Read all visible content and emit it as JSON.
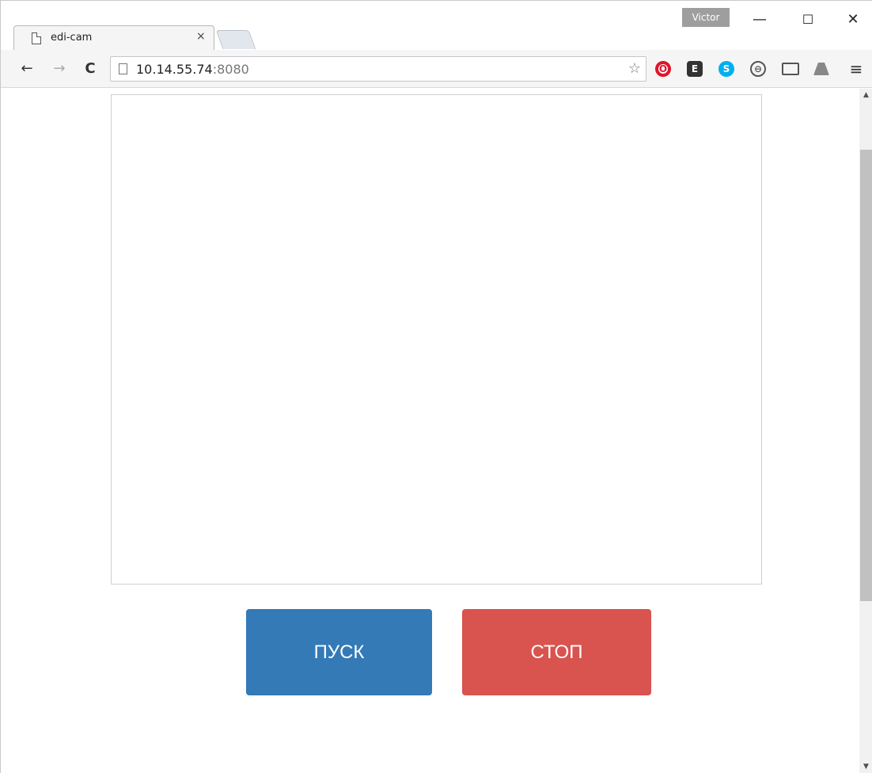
{
  "window": {
    "profile_name": "Victor",
    "minimize_glyph": "—",
    "maximize_glyph": "☐",
    "close_glyph": "✕"
  },
  "tab": {
    "title": "edi-cam",
    "close_glyph": "×"
  },
  "toolbar": {
    "back_glyph": "←",
    "forward_glyph": "→",
    "reload_glyph": "C",
    "url_host": "10.14.55.74",
    "url_port": ":8080",
    "bookmark_glyph": "☆",
    "menu_glyph": "≡"
  },
  "extensions": {
    "opera": "O",
    "evernote": "E",
    "skype": "S",
    "sync": "⊖"
  },
  "page": {
    "start_label": "ПУСК",
    "stop_label": "СТОП"
  },
  "colors": {
    "start_button": "#337ab7",
    "stop_button": "#d9534f"
  },
  "scrollbar": {
    "up_glyph": "▲",
    "down_glyph": "▼"
  }
}
